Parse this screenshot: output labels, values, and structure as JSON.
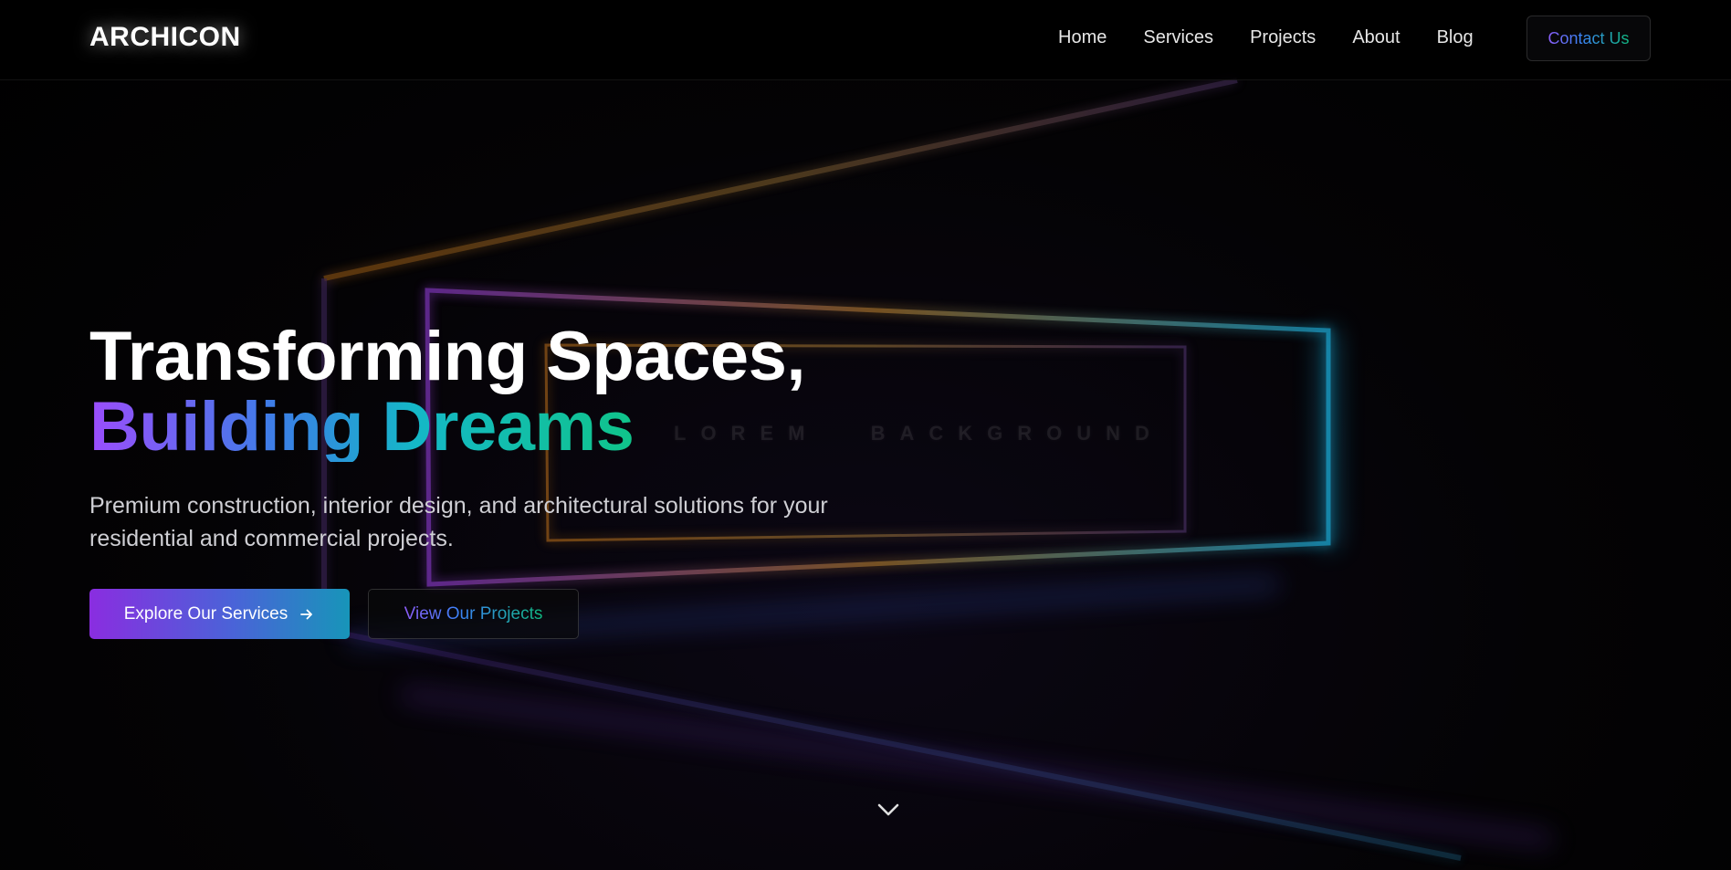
{
  "brand": {
    "logo": "ARCHICON"
  },
  "nav": {
    "items": [
      "Home",
      "Services",
      "Projects",
      "About",
      "Blog"
    ],
    "contact_label": "Contact Us"
  },
  "hero": {
    "title_line1": "Transforming Spaces,",
    "title_line2": "Building Dreams",
    "subtitle": "Premium construction, interior design, and architectural solutions for your residential and commercial projects.",
    "primary_cta": "Explore Our Services",
    "secondary_cta": "View Our Projects",
    "background_words": [
      "LOREM",
      "BACKGROUND"
    ]
  },
  "icons": {
    "primary_cta_icon": "arrow-right-icon",
    "scroll_icon": "chevron-down-icon"
  },
  "colors": {
    "background": "#000000",
    "accent_start": "#8b5cf6",
    "accent_mid": "#3b82f6",
    "accent_end": "#10b981",
    "text": "#ffffff",
    "muted_text": "#cfcfd4"
  }
}
